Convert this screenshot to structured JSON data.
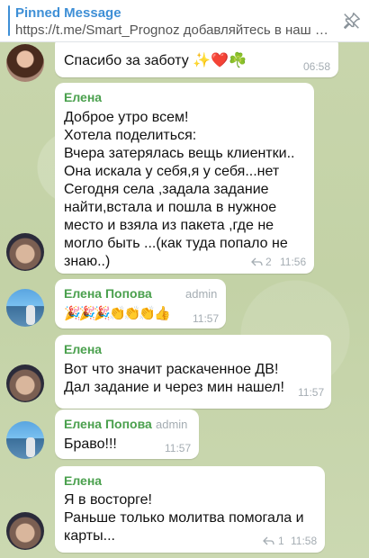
{
  "pinned": {
    "title": "Pinned Message",
    "text": "https://t.me/Smart_Prognoz добавляйтесь в наш ТГ..."
  },
  "messages": [
    {
      "text": "Спасибо за заботу ✨❤️☘️",
      "time": "06:58"
    },
    {
      "sender": "Елена",
      "text": "Доброе утро всем!\nХотела поделиться:\nВчера затерялась вещь клиентки..\nОна искала у себя,я у себя...нет\nСегодня села ,задала задание\nнайти,встала и пошла в нужное\nместо и взяла из пакета ,где не\nмогло быть ...(как туда попало не\nзнаю..)",
      "replies": "2",
      "time": "11:56"
    },
    {
      "sender": "Елена Попова",
      "badge": "admin",
      "text": "🎉🎉🎉👏👏👏👍",
      "time": "11:57"
    },
    {
      "sender": "Елена",
      "text": "Вот что значит раскаченное ДВ!\nДал задание и через мин нашел!",
      "time": "11:57"
    },
    {
      "sender": "Елена Попова",
      "badge": "admin",
      "text": "Браво!!!",
      "time": "11:57"
    },
    {
      "sender": "Елена",
      "text": "Я в восторге!\nРаньше только молитва помогала и\nкарты...",
      "replies": "1",
      "time": "11:58"
    }
  ],
  "icons": {
    "unpin": "unpin-icon",
    "reply": "reply-arrow-icon",
    "avatar": "user-avatar"
  },
  "colors": {
    "accent": "#3e8fd6",
    "sender": "#4aa04d",
    "meta": "#a5adb3"
  }
}
